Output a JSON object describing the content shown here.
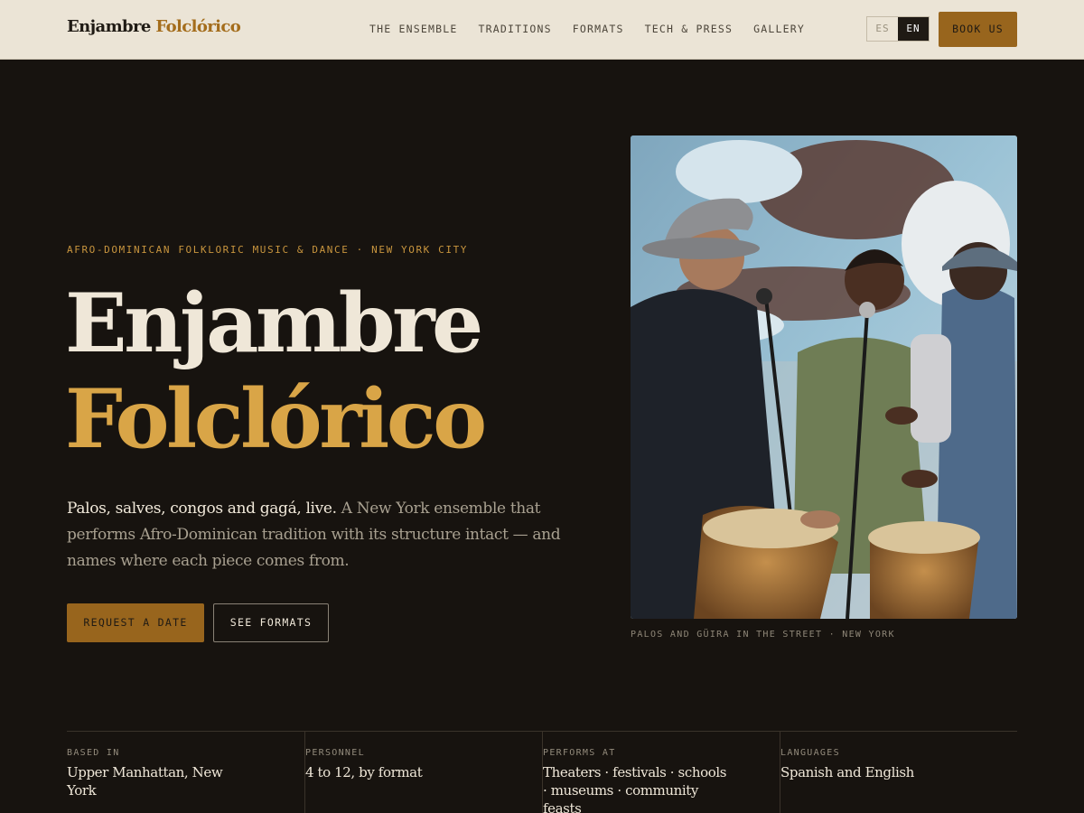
{
  "brand": {
    "part1": "Enjambre",
    "part2": "Folclórico"
  },
  "nav": {
    "items": [
      {
        "label": "THE ENSEMBLE"
      },
      {
        "label": "TRADITIONS"
      },
      {
        "label": "FORMATS"
      },
      {
        "label": "TECH & PRESS"
      },
      {
        "label": "GALLERY"
      }
    ],
    "lang": {
      "es": "ES",
      "en": "EN",
      "active": "EN"
    },
    "book_label": "BOOK US"
  },
  "hero": {
    "eyebrow": "AFRO-DOMINICAN FOLKLORIC MUSIC & DANCE · NEW YORK CITY",
    "title_line1": "Enjambre",
    "title_line2": "Folclórico",
    "lede_strong": "Palos, salves, congos and gagá, live.",
    "lede_rest": "A New York ensemble that performs Afro-Dominican tradition with its structure intact — and names where each piece comes from.",
    "primary_cta": "REQUEST A DATE",
    "secondary_cta": "SEE FORMATS"
  },
  "photo": {
    "caption": "PALOS AND GÜIRA IN THE STREET · NEW YORK"
  },
  "facts": [
    {
      "label": "BASED IN",
      "value": "Upper Manhattan, New York"
    },
    {
      "label": "PERSONNEL",
      "value": "4 to 12, by format"
    },
    {
      "label": "PERFORMS AT",
      "value": "Theaters · festivals · schools · museums · community feasts"
    },
    {
      "label": "LANGUAGES",
      "value": "Spanish and English"
    }
  ],
  "colors": {
    "page_bg": "#17130f",
    "nav_bg": "#ebe4d6",
    "accent": "#98651d",
    "gold": "#d9a547"
  }
}
